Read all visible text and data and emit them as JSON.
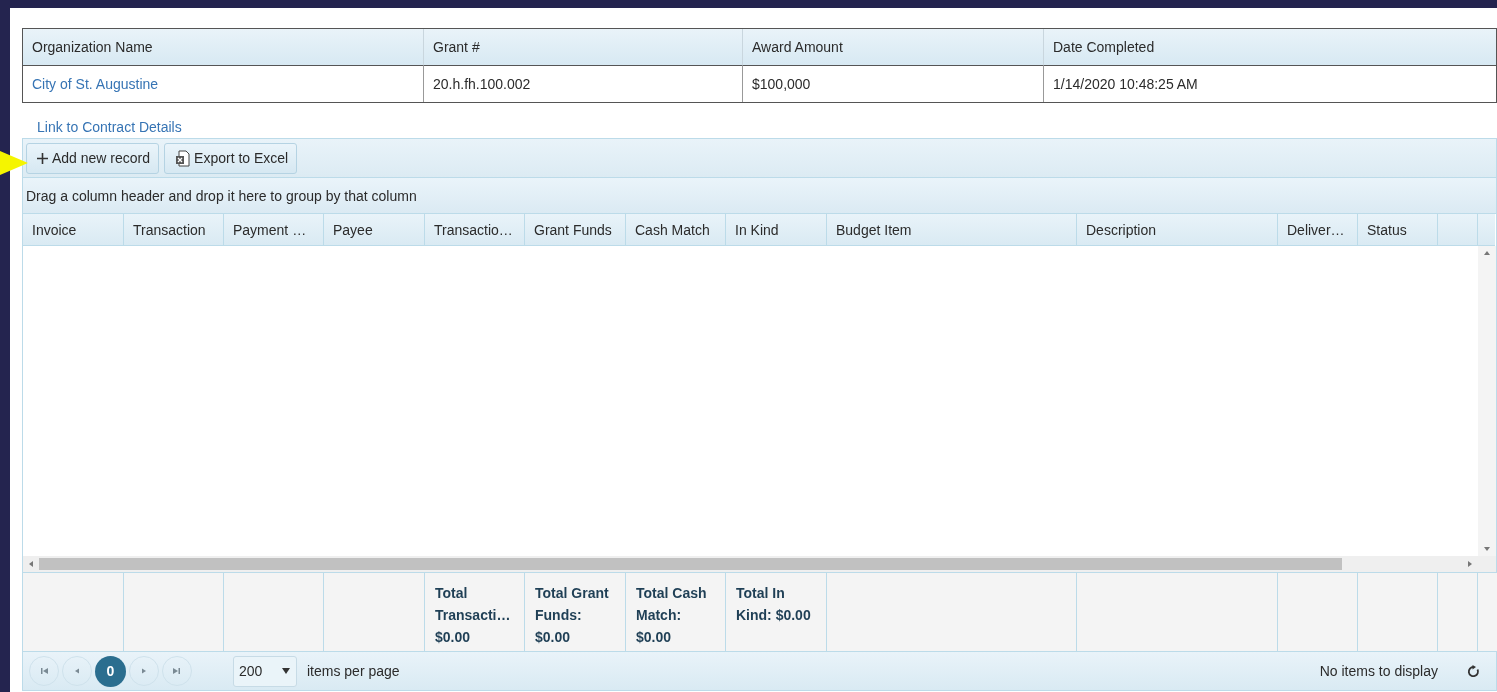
{
  "summary": {
    "columns": [
      "Organization Name",
      "Grant #",
      "Award Amount",
      "Date Completed"
    ],
    "row": [
      {
        "text": "City of St. Augustine",
        "kind": "link"
      },
      {
        "text": "20.h.fh.100.002",
        "kind": "text"
      },
      {
        "text": "$100,000",
        "kind": "text"
      },
      {
        "text": "1/14/2020 10:48:25 AM",
        "kind": "text"
      }
    ]
  },
  "contract_link": "Link to Contract Details",
  "toolbar": [
    {
      "label": "Add new record",
      "kind": "add"
    },
    {
      "label": "Export to Excel",
      "kind": "excel"
    }
  ],
  "group_hint": "Drag a column header and drop it here to group by that column",
  "grid": {
    "columns": [
      {
        "label": "Invoice"
      },
      {
        "label": "Transaction"
      },
      {
        "label": "Payment …"
      },
      {
        "label": "Payee"
      },
      {
        "label": "Transactio…",
        "total": "Total Transacti… $0.00"
      },
      {
        "label": "Grant Funds",
        "total": "Total Grant Funds: $0.00"
      },
      {
        "label": "Cash Match",
        "total": "Total Cash Match: $0.00"
      },
      {
        "label": "In Kind",
        "total": "Total In Kind: $0.00"
      },
      {
        "label": "Budget Item"
      },
      {
        "label": "Description"
      },
      {
        "label": "Deliver…"
      },
      {
        "label": "Status"
      }
    ]
  },
  "pager": {
    "pages": [
      {
        "label": "0",
        "selected": true
      }
    ],
    "page_size": "200",
    "page_size_label": "items per page",
    "info": "No items to display"
  }
}
